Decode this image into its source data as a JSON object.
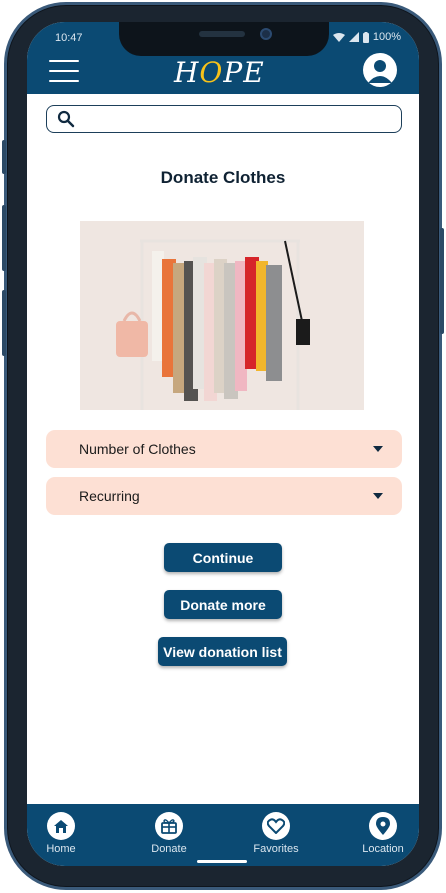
{
  "status_bar": {
    "time": "10:47",
    "battery": "100%"
  },
  "header": {
    "logo_prefix": "H",
    "logo_o": "O",
    "logo_suffix": "PE",
    "logo_accent": "#f7c21a",
    "bg_color": "#0b4a73"
  },
  "search": {
    "placeholder": "",
    "value": ""
  },
  "page": {
    "title": "Donate Clothes"
  },
  "image": {
    "subject": "clothes-rack-photo"
  },
  "form": {
    "dropdowns": [
      {
        "label": "Number of Clothes"
      },
      {
        "label": "Recurring"
      }
    ]
  },
  "actions": {
    "continue_label": "Continue",
    "donate_more_label": "Donate more",
    "view_list_label": "View donation list"
  },
  "bottom_nav": {
    "items": [
      {
        "label": "Home",
        "icon": "home-icon"
      },
      {
        "label": "Donate",
        "icon": "gift-icon"
      },
      {
        "label": "Favorites",
        "icon": "heart-icon"
      },
      {
        "label": "Location",
        "icon": "location-pin-icon"
      }
    ]
  },
  "colors": {
    "primary": "#0b4a73",
    "dropdown_bg": "#fde0d4",
    "title": "#0f2233"
  }
}
